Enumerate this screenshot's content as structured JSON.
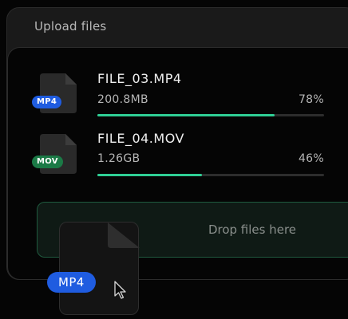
{
  "panel": {
    "title": "Upload files"
  },
  "files": [
    {
      "name": "FILE_03.MP4",
      "type": "MP4",
      "size": "200.8MB",
      "percent_label": "78%",
      "progress": 0.78,
      "badge_color": "#1f5ce0"
    },
    {
      "name": "FILE_04.MOV",
      "type": "MOV",
      "size": "1.26GB",
      "percent_label": "46%",
      "progress": 0.46,
      "badge_color": "#1b7a46"
    }
  ],
  "dropzone": {
    "label": "Drop files here"
  },
  "dragged_file": {
    "type": "MP4"
  },
  "colors": {
    "progress": "#2fcf95",
    "accent_blue": "#1f5ce0",
    "accent_green": "#1b7a46"
  },
  "icons": {
    "file": "file-icon",
    "cursor": "cursor-arrow-icon"
  }
}
